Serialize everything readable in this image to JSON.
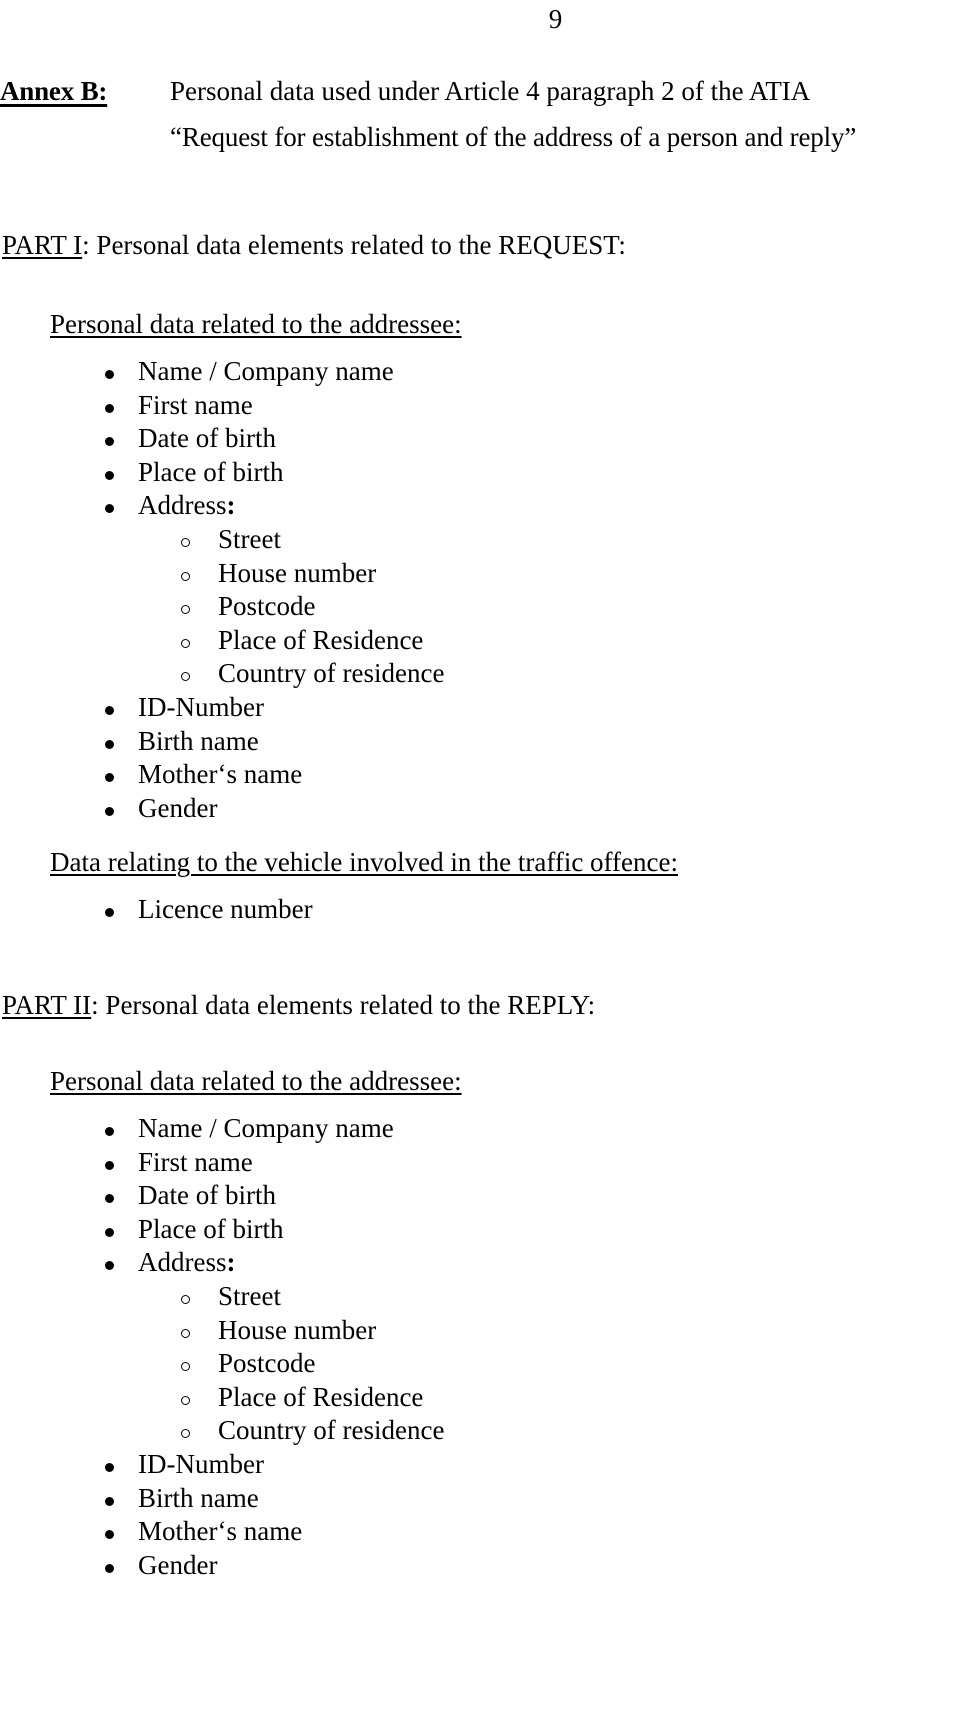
{
  "document": {
    "page_number": "9",
    "annex_label": "Annex B:",
    "title_line_1": "Personal data used under Article 4 paragraph 2 of the ATIA",
    "title_line_2": "“Request for establishment of the address of a person and reply”"
  },
  "part1": {
    "heading_underlined": "PART I",
    "heading_rest": ": Personal data elements related to the REQUEST:",
    "addressee_heading": "Personal data related to the addressee:",
    "items": [
      {
        "level": 1,
        "label": "Name / Company name"
      },
      {
        "level": 1,
        "label": "First name"
      },
      {
        "level": 1,
        "label": "Date of birth"
      },
      {
        "level": 1,
        "label": "Place of birth"
      },
      {
        "level": 1,
        "label": "Address",
        "colon": ":"
      },
      {
        "level": 2,
        "label": "Street"
      },
      {
        "level": 2,
        "label": "House number"
      },
      {
        "level": 2,
        "label": "Postcode"
      },
      {
        "level": 2,
        "label": "Place of Residence"
      },
      {
        "level": 2,
        "label": "Country of residence"
      },
      {
        "level": 1,
        "label": "ID-Number"
      },
      {
        "level": 1,
        "label": "Birth name"
      },
      {
        "level": 1,
        "label": "Mother‘s name"
      },
      {
        "level": 1,
        "label": "Gender"
      }
    ],
    "vehicle_heading": "Data relating to the vehicle involved in the traffic offence:",
    "vehicle_items": [
      {
        "level": 1,
        "label": "Licence number"
      }
    ]
  },
  "part2": {
    "heading_underlined": "PART II",
    "heading_rest": ": Personal data elements related to the REPLY:",
    "addressee_heading": "Personal data related to the addressee:",
    "items": [
      {
        "level": 1,
        "label": "Name / Company name"
      },
      {
        "level": 1,
        "label": "First name"
      },
      {
        "level": 1,
        "label": "Date of birth"
      },
      {
        "level": 1,
        "label": "Place of birth"
      },
      {
        "level": 1,
        "label": "Address",
        "colon": ":"
      },
      {
        "level": 2,
        "label": "Street"
      },
      {
        "level": 2,
        "label": "House number"
      },
      {
        "level": 2,
        "label": "Postcode"
      },
      {
        "level": 2,
        "label": "Place of Residence"
      },
      {
        "level": 2,
        "label": "Country of residence"
      },
      {
        "level": 1,
        "label": "ID-Number"
      },
      {
        "level": 1,
        "label": "Birth name"
      },
      {
        "level": 1,
        "label": "Mother‘s name"
      },
      {
        "level": 1,
        "label": "Gender"
      }
    ]
  }
}
